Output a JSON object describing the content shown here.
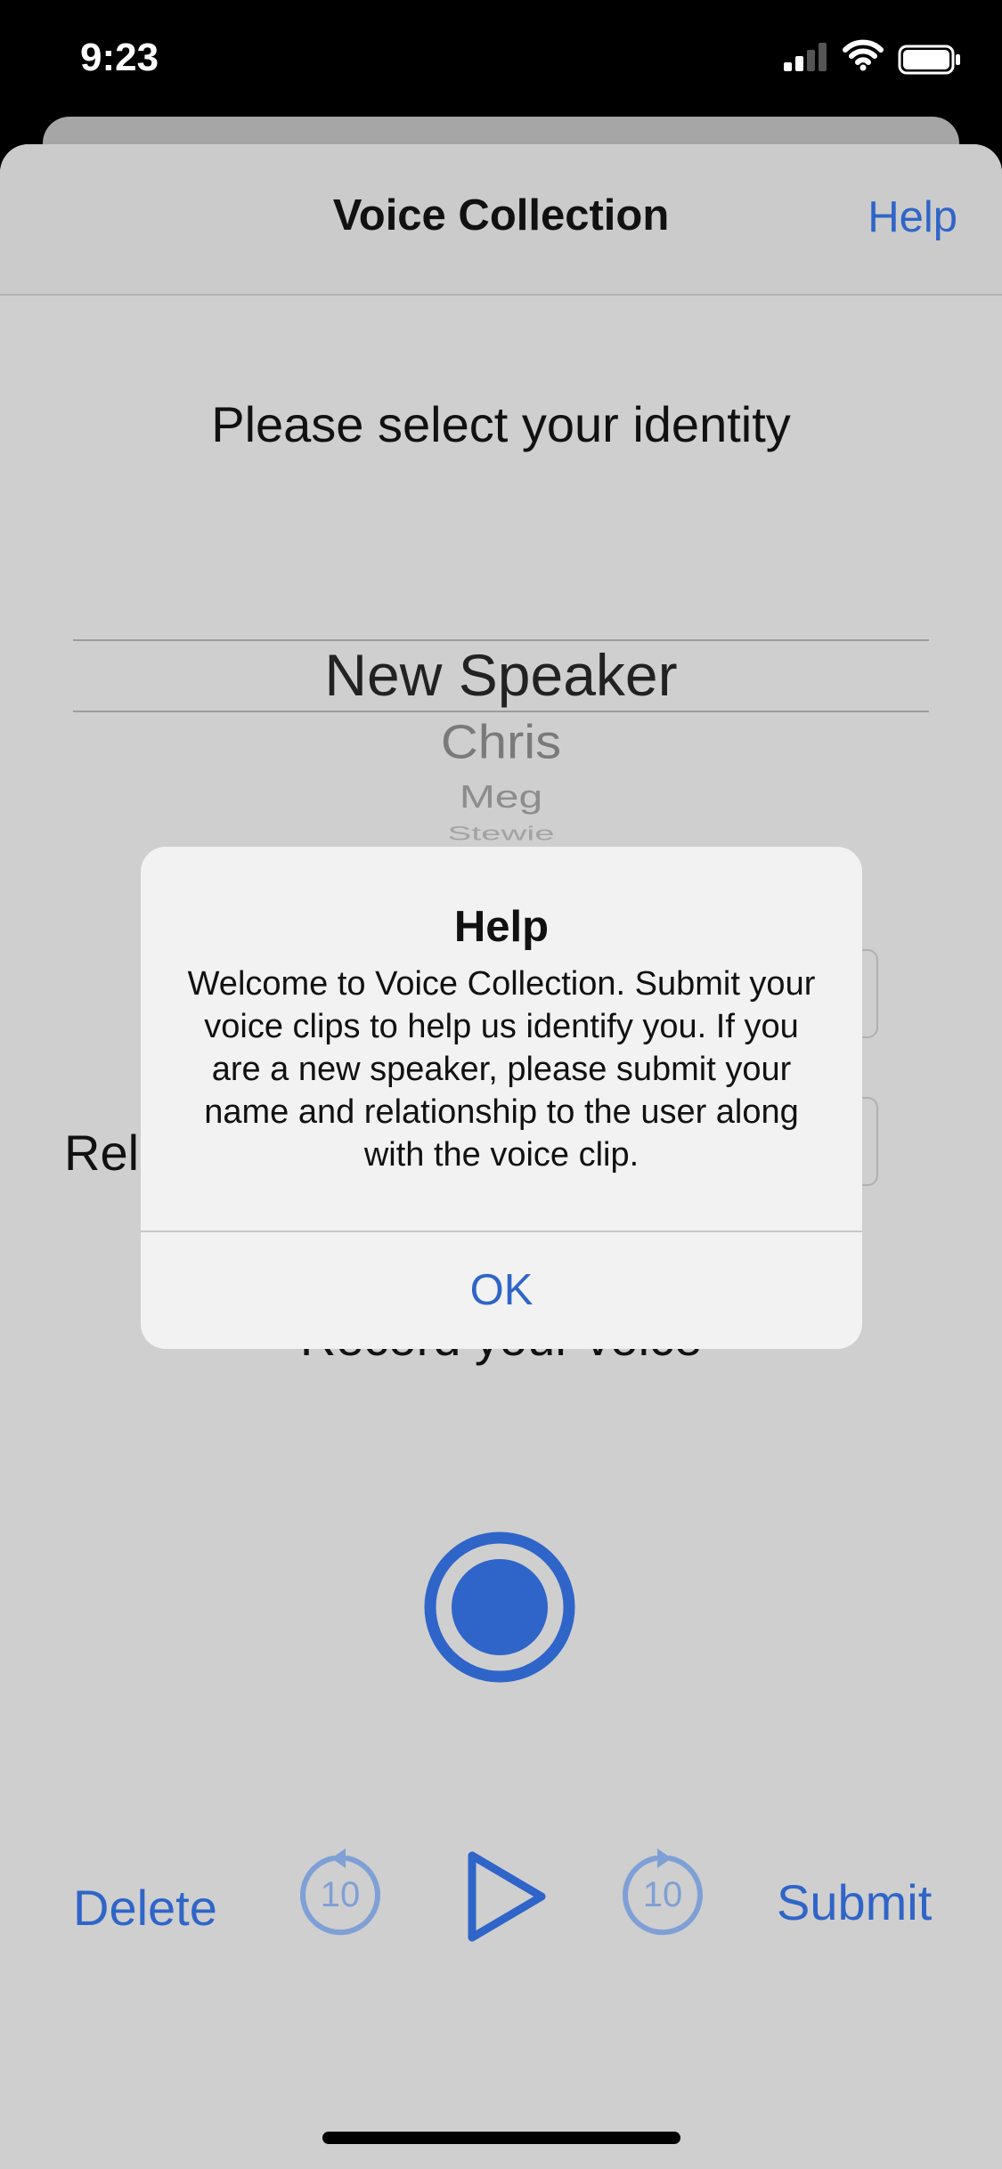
{
  "status_bar": {
    "time": "9:23"
  },
  "nav": {
    "title": "Voice Collection",
    "help": "Help"
  },
  "prompt": "Please select your identity",
  "picker": {
    "options": [
      "New Speaker",
      "Chris",
      "Meg",
      "Stewie"
    ],
    "selected": "New Speaker"
  },
  "form": {
    "relationship_label_partial": "Rel"
  },
  "record": {
    "label": "Record your voice"
  },
  "controls": {
    "delete": "Delete",
    "rewind_seconds": "10",
    "forward_seconds": "10",
    "submit": "Submit"
  },
  "alert": {
    "title": "Help",
    "message": "Welcome to Voice Collection. Submit your voice clips to help us identify you. If you are a new speaker, please submit your name and relationship to the user along with the voice clip.",
    "ok": "OK"
  },
  "colors": {
    "accent": "#2f65c8",
    "sheet": "#cfcfcf",
    "alert_bg": "#f2f2f2"
  }
}
